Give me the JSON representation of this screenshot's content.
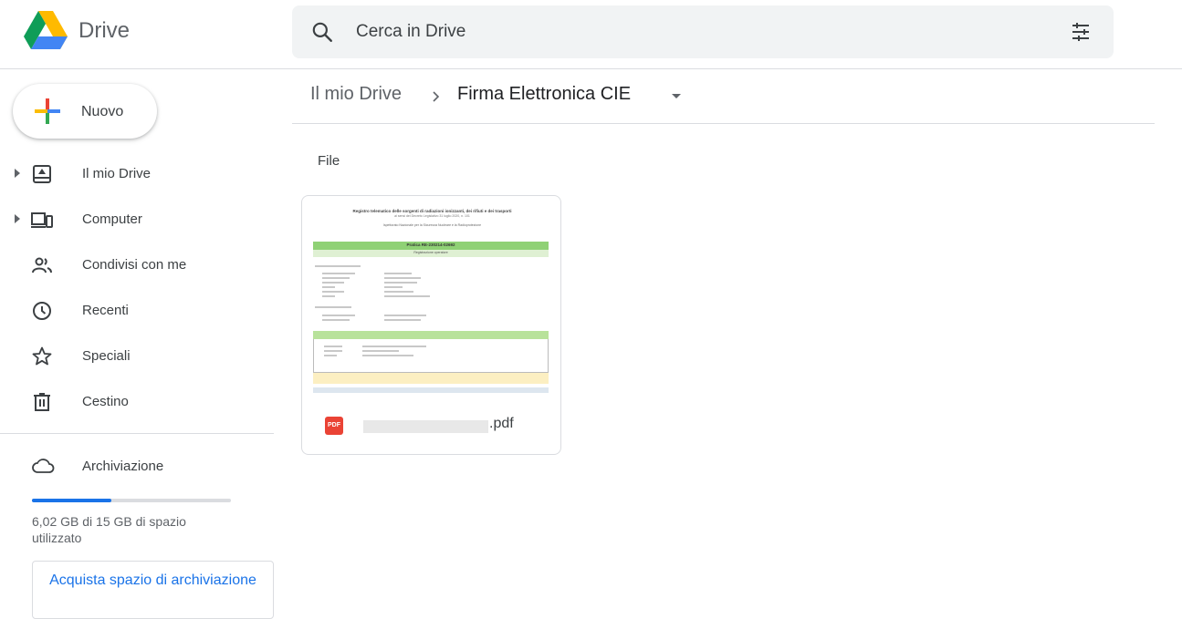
{
  "app": {
    "name": "Drive"
  },
  "search": {
    "placeholder": "Cerca in Drive"
  },
  "sidebar": {
    "new_label": "Nuovo",
    "items": [
      {
        "label": "Il mio Drive",
        "icon": "my-drive-icon",
        "expandable": true
      },
      {
        "label": "Computer",
        "icon": "computer-icon",
        "expandable": true
      },
      {
        "label": "Condivisi con me",
        "icon": "shared-icon",
        "expandable": false
      },
      {
        "label": "Recenti",
        "icon": "clock-icon",
        "expandable": false
      },
      {
        "label": "Speciali",
        "icon": "star-icon",
        "expandable": false
      },
      {
        "label": "Cestino",
        "icon": "trash-icon",
        "expandable": false
      }
    ],
    "storage": {
      "label": "Archiviazione",
      "usage_text": "6,02 GB di 15 GB di spazio utilizzato",
      "used_fraction": 0.401,
      "buy_label": "Acquista spazio di archiviazione"
    }
  },
  "breadcrumb": {
    "root": "Il mio Drive",
    "current": "Firma Elettronica CIE"
  },
  "main": {
    "section_title": "File",
    "files": [
      {
        "badge": "PDF",
        "extension": ".pdf",
        "thumbnail": {
          "title": "Registro telematico delle sorgenti di radiazioni ionizzanti, dei rifiuti e dei trasporti",
          "subtitle": "ai sensi del Decreto Legislativo 31 luglio 2020, n. 101",
          "institute": "Ispettorato Nazionale per la Sicurezza Nucleare e la Radioprotezione",
          "banner": "Pratica RE-230214-02692",
          "banner_sub": "Registrazione operatore"
        }
      }
    ]
  },
  "colors": {
    "accent": "#1a73e8",
    "pdf_red": "#ea4335",
    "search_bg": "#f1f3f4"
  }
}
